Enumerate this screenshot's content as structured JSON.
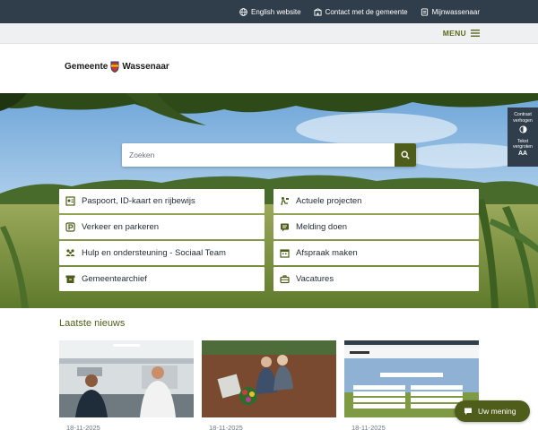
{
  "topbar": {
    "english": "English website",
    "contact": "Contact met de gemeente",
    "mijn": "Mijnwassenaar"
  },
  "menu": {
    "label": "MENU"
  },
  "logo": {
    "text": "Gemeente Wassenaar",
    "icon": "coat-of-arms-icon"
  },
  "search": {
    "placeholder": "Zoeken",
    "icon": "search-icon"
  },
  "tiles": [
    {
      "label": "Paspoort, ID-kaart en rijbewijs",
      "icon": "passport-icon"
    },
    {
      "label": "Actuele projecten",
      "icon": "workers-icon"
    },
    {
      "label": "Verkeer en parkeren",
      "icon": "parking-icon"
    },
    {
      "label": "Melding doen",
      "icon": "report-icon"
    },
    {
      "label": "Hulp en ondersteuning - Sociaal Team",
      "icon": "people-icon"
    },
    {
      "label": "Afspraak maken",
      "icon": "calendar-icon"
    },
    {
      "label": "Gemeentearchief",
      "icon": "archive-icon"
    },
    {
      "label": "Vacatures",
      "icon": "briefcase-icon"
    }
  ],
  "a11y": {
    "contrast_line1": "Contrast",
    "contrast_line2": "verhogen",
    "text_line1": "Tekst",
    "text_line2": "vergroten",
    "text_glyph": "AA"
  },
  "news": {
    "title": "Laatste nieuws",
    "cards": [
      {
        "date": "18-11-2025"
      },
      {
        "date": "18-11-2025"
      },
      {
        "date": "18-11-2025"
      }
    ]
  },
  "feedback": {
    "label": "Uw mening",
    "icon": "chat-icon"
  },
  "colors": {
    "brand": "#4f5d1b",
    "topbar": "#2f3e4a"
  }
}
